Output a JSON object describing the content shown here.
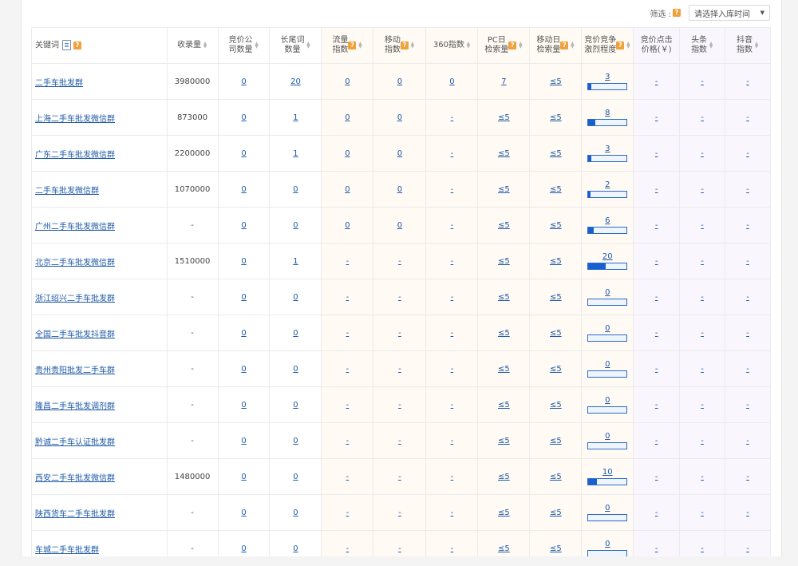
{
  "filter": {
    "label": "筛选 :",
    "help": "?",
    "select_placeholder": "请选择入库时间"
  },
  "columns": {
    "keyword": "关键词",
    "shoulu": "收录量",
    "jingjia_a": "竞价公",
    "jingjia_b": "司数量",
    "changwei_a": "长尾词",
    "changwei_b": "数量",
    "liuliang_a": "流量",
    "liuliang_b": "指数",
    "yidong_a": "移动",
    "yidong_b": "指数",
    "idx360": "360指数",
    "pc_a": "PC日",
    "pc_b": "检索量",
    "mob_a": "移动日",
    "mob_b": "检索量",
    "comp_a": "竞价竞争",
    "comp_b": "激烈程度",
    "click_a": "竞价点击",
    "click_b": "价格(￥)",
    "toutiao_a": "头条",
    "toutiao_b": "指数",
    "douyin_a": "抖音",
    "douyin_b": "指数"
  },
  "rows": [
    {
      "kw": "二手车批发群",
      "shoulu": "3980000",
      "jingjia": "0",
      "changwei": "20",
      "liuliang": "0",
      "yidong": "0",
      "i360": "0",
      "pc": "7",
      "mob": "≤5",
      "comp": "3",
      "click": "-",
      "toutiao": "-",
      "douyin": "-"
    },
    {
      "kw": "上海二手车批发微信群",
      "shoulu": "873000",
      "jingjia": "0",
      "changwei": "1",
      "liuliang": "0",
      "yidong": "0",
      "i360": "-",
      "pc": "≤5",
      "mob": "≤5",
      "comp": "8",
      "click": "-",
      "toutiao": "-",
      "douyin": "-"
    },
    {
      "kw": "广东二手车批发微信群",
      "shoulu": "2200000",
      "jingjia": "0",
      "changwei": "1",
      "liuliang": "0",
      "yidong": "0",
      "i360": "-",
      "pc": "≤5",
      "mob": "≤5",
      "comp": "3",
      "click": "-",
      "toutiao": "-",
      "douyin": "-"
    },
    {
      "kw": "二手车批发微信群",
      "shoulu": "1070000",
      "jingjia": "0",
      "changwei": "0",
      "liuliang": "0",
      "yidong": "0",
      "i360": "-",
      "pc": "≤5",
      "mob": "≤5",
      "comp": "2",
      "click": "-",
      "toutiao": "-",
      "douyin": "-"
    },
    {
      "kw": "广州二手车批发微信群",
      "shoulu": "-",
      "jingjia": "0",
      "changwei": "0",
      "liuliang": "0",
      "yidong": "0",
      "i360": "-",
      "pc": "≤5",
      "mob": "≤5",
      "comp": "6",
      "click": "-",
      "toutiao": "-",
      "douyin": "-"
    },
    {
      "kw": "北京二手车批发微信群",
      "shoulu": "1510000",
      "jingjia": "0",
      "changwei": "1",
      "liuliang": "-",
      "yidong": "-",
      "i360": "-",
      "pc": "≤5",
      "mob": "≤5",
      "comp": "20",
      "click": "-",
      "toutiao": "-",
      "douyin": "-"
    },
    {
      "kw": "浙江绍兴二手车批发群",
      "shoulu": "-",
      "jingjia": "0",
      "changwei": "0",
      "liuliang": "-",
      "yidong": "-",
      "i360": "-",
      "pc": "≤5",
      "mob": "≤5",
      "comp": "0",
      "click": "-",
      "toutiao": "-",
      "douyin": "-"
    },
    {
      "kw": "全国二手车批发抖音群",
      "shoulu": "-",
      "jingjia": "0",
      "changwei": "0",
      "liuliang": "-",
      "yidong": "-",
      "i360": "-",
      "pc": "≤5",
      "mob": "≤5",
      "comp": "0",
      "click": "-",
      "toutiao": "-",
      "douyin": "-"
    },
    {
      "kw": "贵州贵阳批发二手车群",
      "shoulu": "-",
      "jingjia": "0",
      "changwei": "0",
      "liuliang": "-",
      "yidong": "-",
      "i360": "-",
      "pc": "≤5",
      "mob": "≤5",
      "comp": "0",
      "click": "-",
      "toutiao": "-",
      "douyin": "-"
    },
    {
      "kw": "隆昌二手车批发调剂群",
      "shoulu": "-",
      "jingjia": "0",
      "changwei": "0",
      "liuliang": "-",
      "yidong": "-",
      "i360": "-",
      "pc": "≤5",
      "mob": "≤5",
      "comp": "0",
      "click": "-",
      "toutiao": "-",
      "douyin": "-"
    },
    {
      "kw": "黔诚二手车认证批发群",
      "shoulu": "-",
      "jingjia": "0",
      "changwei": "0",
      "liuliang": "-",
      "yidong": "-",
      "i360": "-",
      "pc": "≤5",
      "mob": "≤5",
      "comp": "0",
      "click": "-",
      "toutiao": "-",
      "douyin": "-"
    },
    {
      "kw": "西安二手车批发微信群",
      "shoulu": "1480000",
      "jingjia": "0",
      "changwei": "0",
      "liuliang": "-",
      "yidong": "-",
      "i360": "-",
      "pc": "≤5",
      "mob": "≤5",
      "comp": "10",
      "click": "-",
      "toutiao": "-",
      "douyin": "-"
    },
    {
      "kw": "陕西货车二手车批发群",
      "shoulu": "-",
      "jingjia": "0",
      "changwei": "0",
      "liuliang": "-",
      "yidong": "-",
      "i360": "-",
      "pc": "≤5",
      "mob": "≤5",
      "comp": "0",
      "click": "-",
      "toutiao": "-",
      "douyin": "-"
    },
    {
      "kw": "车城二手车批发群",
      "shoulu": "-",
      "jingjia": "0",
      "changwei": "0",
      "liuliang": "-",
      "yidong": "-",
      "i360": "-",
      "pc": "≤5",
      "mob": "≤5",
      "comp": "0",
      "click": "-",
      "toutiao": "-",
      "douyin": "-"
    }
  ],
  "colors": {
    "link": "#1f5aa8",
    "help_badge": "#f0a13c",
    "bar": "#1a5fd0"
  }
}
